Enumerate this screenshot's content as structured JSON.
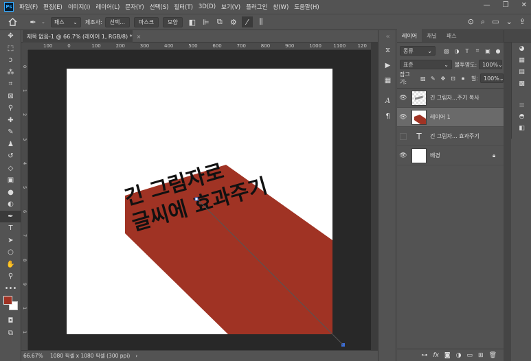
{
  "menu": [
    "파일(F)",
    "편집(E)",
    "이미지(I)",
    "레이어(L)",
    "문자(Y)",
    "선택(S)",
    "필터(T)",
    "3D(D)",
    "보기(V)",
    "플러그인",
    "창(W)",
    "도움말(H)"
  ],
  "options": {
    "path_mode": "패스",
    "make_label": "제조사:",
    "selection_btn": "선택...",
    "mask_btn": "마스크",
    "shape_btn": "모양"
  },
  "document": {
    "tab_title": "제목 없음-1 @ 66.7% (레이어 1, RGB/8) *",
    "close": "×",
    "zoom": "66.67%",
    "info": "1080 픽셀 x 1080 픽셀 (300 ppi)",
    "arrow": "›"
  },
  "ruler": {
    "h_ticks": [
      "100",
      "0",
      "100",
      "200",
      "300",
      "400",
      "500",
      "600",
      "700",
      "800",
      "900",
      "1000",
      "1100",
      "120"
    ],
    "v_ticks": [
      "0",
      "1",
      "2",
      "3",
      "4",
      "5",
      "6",
      "7",
      "8",
      "9",
      "1",
      "1"
    ]
  },
  "canvas_text": {
    "line1": "긴 그림자로",
    "line2": "글씨에 효과주기"
  },
  "colors": {
    "shadow": "#a03324",
    "foreground": "#a03324",
    "background": "#ffffff",
    "path": "#3b6dd6"
  },
  "layers_panel": {
    "tabs": [
      "레이어",
      "채널",
      "패스"
    ],
    "kind_label": "종류",
    "blend_mode": "표준",
    "opacity_label": "불투명도:",
    "opacity_value": "100%",
    "lock_label": "잠그기:",
    "fill_label": "칠:",
    "fill_value": "100%",
    "layers": [
      {
        "name": "긴 그림자...주기 복사",
        "visible": true,
        "kind": "checker"
      },
      {
        "name": "레이어 1",
        "visible": true,
        "kind": "red",
        "active": true
      },
      {
        "name": "긴 그림자... 효과주기",
        "visible": false,
        "kind": "text"
      },
      {
        "name": "배경",
        "visible": true,
        "kind": "white",
        "locked": true
      }
    ],
    "text_thumb": "T",
    "fx_label": "fx"
  }
}
